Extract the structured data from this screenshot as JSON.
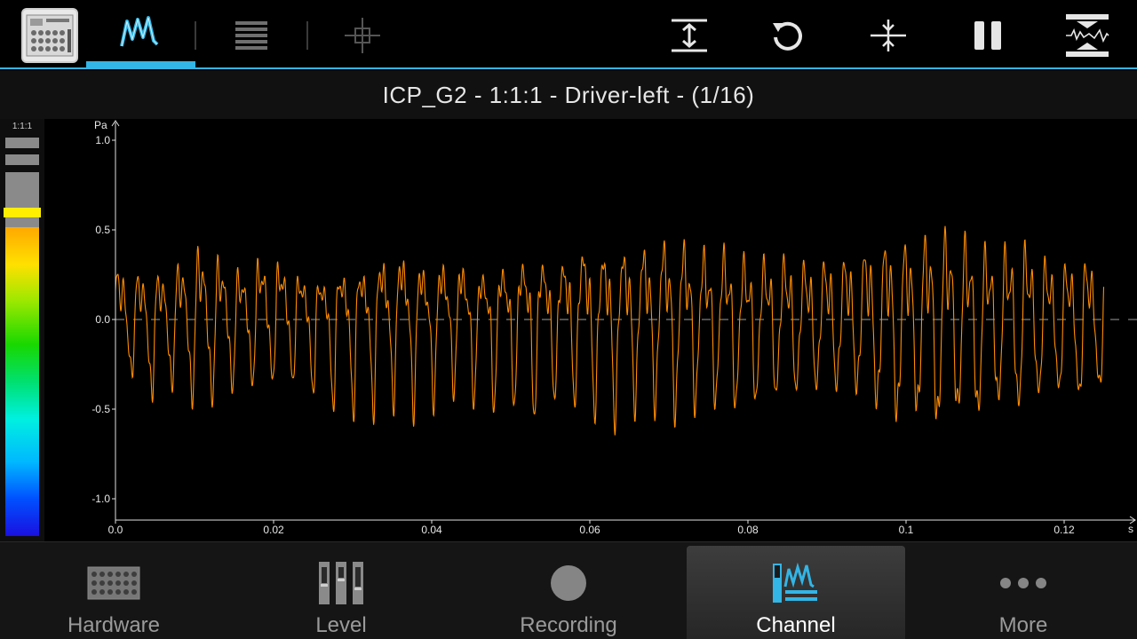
{
  "title": "ICP_G2 - 1:1:1 - Driver-left - (1/16)",
  "meter": {
    "label": "1:1:1",
    "peak_level": 0.77
  },
  "toolbar": {
    "tabs": [
      {
        "name": "waveform",
        "icon": "waveform-icon",
        "active": true
      },
      {
        "name": "list",
        "icon": "list-icon",
        "active": false
      },
      {
        "name": "cursor",
        "icon": "crosshair-icon",
        "active": false
      }
    ],
    "actions": [
      "fit-vertical-icon",
      "reset-icon",
      "zoom-center-icon",
      "pause-icon",
      "autoscale-icon"
    ]
  },
  "chart_data": {
    "type": "line",
    "xlabel": "s",
    "ylabel": "Pa",
    "xlim": [
      0.0,
      0.125
    ],
    "ylim": [
      -1.1,
      1.1
    ],
    "xticks": [
      "0.0",
      "0.02",
      "0.04",
      "0.06",
      "0.08",
      "0.1",
      "0.12"
    ],
    "yticks": [
      "1.0",
      "0.5",
      "0.0",
      "-0.5",
      "-1.0"
    ],
    "series": [
      {
        "color": "#ff8c00",
        "peaks": [
          0.43,
          0.38,
          0.36,
          0.45,
          0.59,
          0.5,
          0.4,
          0.55,
          0.5,
          0.38,
          0.35,
          0.45,
          0.44,
          0.6,
          0.57,
          0.43,
          0.59,
          0.4,
          0.45,
          0.52,
          0.55,
          0.48,
          0.66,
          0.58,
          0.6,
          0.62,
          0.67,
          0.65,
          0.58,
          0.58,
          0.5,
          0.49,
          0.5,
          0.45,
          0.48,
          0.5,
          0.58,
          0.6,
          0.6,
          0.68,
          0.67,
          0.56,
          0.52,
          0.6,
          0.48,
          0.43,
          0.47,
          0.48
        ],
        "troughs": [
          -0.32,
          -0.38,
          -0.54,
          -0.38,
          -0.59,
          -0.45,
          -0.42,
          -0.38,
          -0.36,
          -0.4,
          -0.52,
          -0.55,
          -0.58,
          -0.48,
          -0.55,
          -0.5,
          -0.42,
          -0.48,
          -0.52,
          -0.5,
          -0.58,
          -0.45,
          -0.5,
          -0.58,
          -0.62,
          -0.5,
          -0.55,
          -0.6,
          -0.5,
          -0.55,
          -0.55,
          -0.5,
          -0.48,
          -0.45,
          -0.46,
          -0.45,
          -0.55,
          -0.68,
          -0.62,
          -0.73,
          -0.64,
          -0.68,
          -0.58,
          -0.62,
          -0.52,
          -0.5,
          -0.55,
          -0.45
        ]
      }
    ]
  },
  "nav": {
    "tabs": [
      {
        "label": "Hardware",
        "active": false
      },
      {
        "label": "Level",
        "active": false
      },
      {
        "label": "Recording",
        "active": false
      },
      {
        "label": "Channel",
        "active": true
      },
      {
        "label": "More",
        "active": false
      }
    ]
  }
}
